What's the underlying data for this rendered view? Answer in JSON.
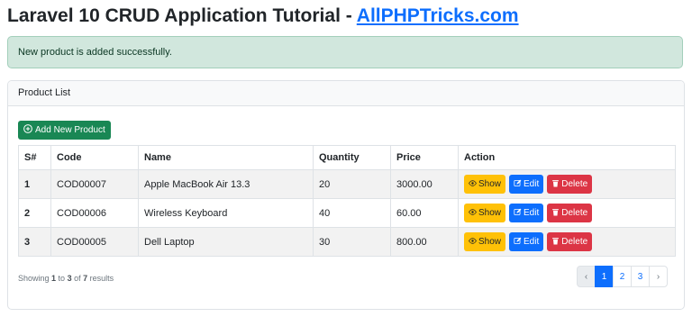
{
  "title": {
    "prefix": "Laravel 10 CRUD Application Tutorial - ",
    "link": "AllPHPTricks.com"
  },
  "alert": {
    "message": "New product is added successfully."
  },
  "card": {
    "header": "Product List",
    "add_button": "Add New Product"
  },
  "table": {
    "headers": [
      "S#",
      "Code",
      "Name",
      "Quantity",
      "Price",
      "Action"
    ],
    "rows": [
      {
        "sno": "1",
        "code": "COD00007",
        "name": "Apple MacBook Air 13.3",
        "quantity": "20",
        "price": "3000.00"
      },
      {
        "sno": "2",
        "code": "COD00006",
        "name": "Wireless Keyboard",
        "quantity": "40",
        "price": "60.00"
      },
      {
        "sno": "3",
        "code": "COD00005",
        "name": "Dell Laptop",
        "quantity": "30",
        "price": "800.00"
      }
    ],
    "actions": {
      "show": "Show",
      "edit": "Edit",
      "delete": "Delete"
    }
  },
  "footer": {
    "showing": {
      "pre": "Showing ",
      "from": "1",
      "mid1": " to ",
      "to": "3",
      "mid2": " of ",
      "total": "7",
      "post": " results"
    },
    "pagination": {
      "prev": "‹",
      "pages": [
        "1",
        "2",
        "3"
      ],
      "next": "›",
      "active": "1"
    }
  },
  "colors": {
    "primary": "#0d6efd",
    "success": "#198754",
    "warning": "#ffc107",
    "danger": "#dc3545",
    "alert_bg": "#d1e7dd"
  }
}
